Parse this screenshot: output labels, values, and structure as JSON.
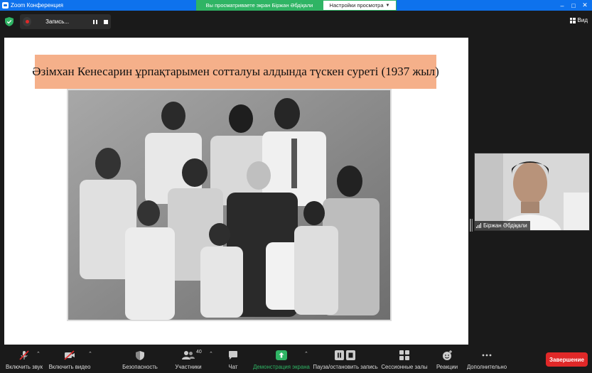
{
  "window": {
    "app_title": "Zoom Конференция"
  },
  "share": {
    "banner_text": "Вы просматриваете экран Біржан Әбдіқали",
    "view_settings_label": "Настройки просмотра"
  },
  "recording": {
    "label": "Запись..."
  },
  "view": {
    "label": "Вид"
  },
  "slide": {
    "title": "Әзімхан Кенесарин ұрпақтарымен сотталуы алдында түскен суреті (1937 жыл)"
  },
  "participant": {
    "name": "Біржан Әбдіқали"
  },
  "toolbar": {
    "audio_label": "Включить звук",
    "video_label": "Включить видео",
    "security_label": "Безопасность",
    "participants_label": "Участники",
    "participants_count": "40",
    "chat_label": "Чат",
    "share_label": "Демонстрация экрана",
    "pause_record_label": "Пауза/остановить запись",
    "breakout_label": "Сессионные залы",
    "reactions_label": "Реакции",
    "more_label": "Дополнительно",
    "end_label": "Завершение"
  },
  "colors": {
    "title_bar": "#0e72ed",
    "share_green": "#2fb464",
    "slide_title_bg": "#f5b08a",
    "end_red": "#e02828"
  }
}
